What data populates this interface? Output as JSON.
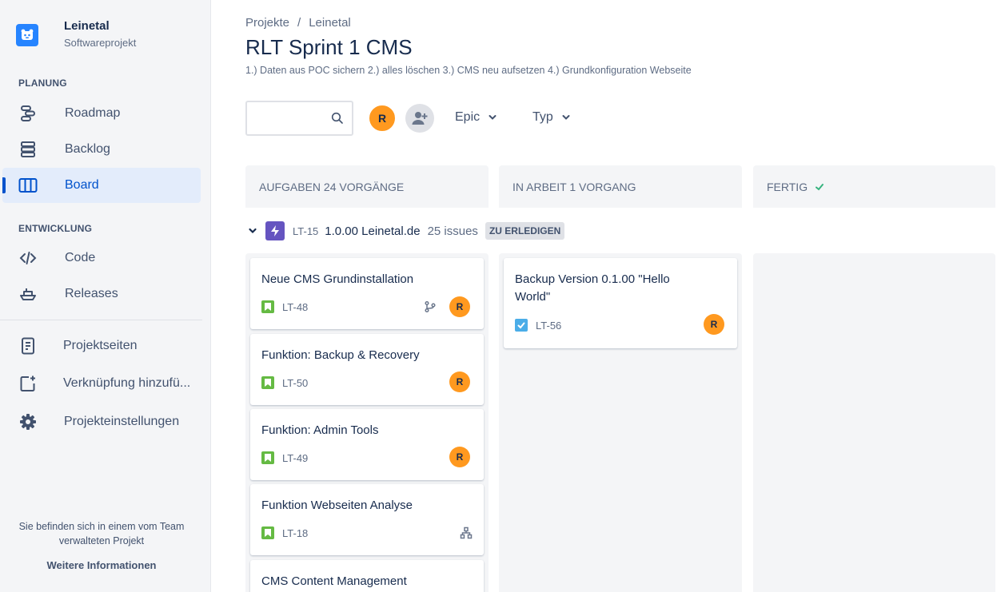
{
  "project": {
    "name": "Leinetal",
    "type": "Softwareprojekt"
  },
  "sidebar": {
    "section_planning": "PLANUNG",
    "section_dev": "ENTWICKLUNG",
    "items": [
      {
        "label": "Roadmap",
        "icon": "roadmap-icon"
      },
      {
        "label": "Backlog",
        "icon": "backlog-icon"
      },
      {
        "label": "Board",
        "icon": "board-icon",
        "active": true
      },
      {
        "label": "Code",
        "icon": "code-icon"
      },
      {
        "label": "Releases",
        "icon": "ship-icon"
      },
      {
        "label": "Projektseiten",
        "icon": "page-icon"
      },
      {
        "label": "Verknüpfung hinzufü...",
        "icon": "add-shortcut-icon"
      },
      {
        "label": "Projekteinstellungen",
        "icon": "gear-icon"
      }
    ],
    "footer_note_line1": "Sie befinden sich in einem vom Team",
    "footer_note_line2": "verwalteten Projekt",
    "footer_link": "Weitere Informationen"
  },
  "breadcrumb": {
    "root": "Projekte",
    "sep": "/",
    "current": "Leinetal"
  },
  "page": {
    "title": "RLT Sprint 1 CMS",
    "description": "1.) Daten aus POC sichern 2.) alles löschen 3.) CMS neu aufsetzen 4.) Grundkonfiguration Webseite"
  },
  "toolbar": {
    "search_placeholder": "",
    "avatar_initial": "R",
    "filter_epic": "Epic",
    "filter_type": "Typ"
  },
  "columns": [
    {
      "title": "AUFGABEN 24 VORGÄNGE"
    },
    {
      "title": "IN ARBEIT 1 VORGANG"
    },
    {
      "title": "FERTIG"
    }
  ],
  "epic": {
    "key": "LT-15",
    "name": "1.0.00 Leinetal.de",
    "count": "25 issues",
    "status": "ZU ERLEDIGEN"
  },
  "cards_todo": [
    {
      "title": "Neue CMS Grundinstallation",
      "key": "LT-48",
      "assignee": "R"
    },
    {
      "title": "Funktion: Backup & Recovery",
      "key": "LT-50",
      "assignee": "R"
    },
    {
      "title": "Funktion: Admin Tools",
      "key": "LT-49",
      "assignee": "R"
    },
    {
      "title": "Funktion Webseiten Analyse",
      "key": "LT-18"
    },
    {
      "title": "CMS Content Management"
    }
  ],
  "cards_inprogress": [
    {
      "title_line1": "Backup Version 0.1.00 \"Hello",
      "title_line2": "World\"",
      "key": "LT-56",
      "assignee": "R"
    }
  ],
  "colors": {
    "accent": "#0052cc",
    "avatar": "#ff991f",
    "story": "#65ba43",
    "task": "#4bade8",
    "epic": "#6554c0",
    "done_check": "#36b37e"
  }
}
